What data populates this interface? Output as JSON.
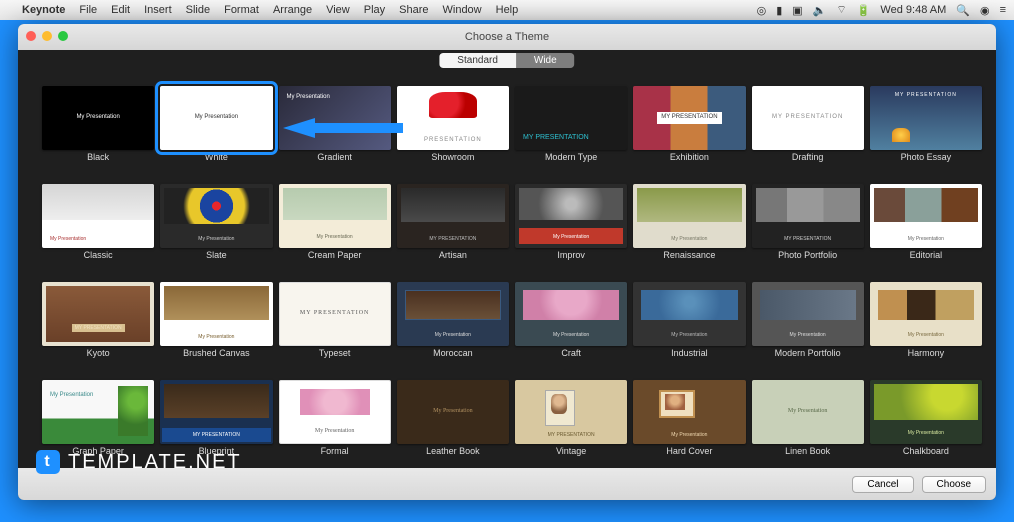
{
  "menubar": {
    "app_name": "Keynote",
    "items": [
      "File",
      "Edit",
      "Insert",
      "Slide",
      "Format",
      "Arrange",
      "View",
      "Play",
      "Share",
      "Window",
      "Help"
    ],
    "right_time": "Wed 9:48 AM"
  },
  "window": {
    "title": "Choose a Theme",
    "segmented": {
      "left": "Standard",
      "right": "Wide",
      "active_index": 0
    }
  },
  "themes": [
    {
      "name": "Black",
      "inner": "My Presentation"
    },
    {
      "name": "White",
      "inner": "My Presentation",
      "selected": true
    },
    {
      "name": "Gradient",
      "inner": "My Presentation"
    },
    {
      "name": "Showroom",
      "inner": "PRESENTATION"
    },
    {
      "name": "Modern Type",
      "inner": "MY PRESENTATION"
    },
    {
      "name": "Exhibition",
      "inner": "MY PRESENTATION"
    },
    {
      "name": "Drafting",
      "inner": "MY PRESENTATION"
    },
    {
      "name": "Photo Essay",
      "inner": "MY PRESENTATION"
    },
    {
      "name": "Classic",
      "inner": "My Presentation"
    },
    {
      "name": "Slate",
      "inner": "My Presentation"
    },
    {
      "name": "Cream Paper",
      "inner": "My Presentation"
    },
    {
      "name": "Artisan",
      "inner": "MY PRESENTATION"
    },
    {
      "name": "Improv",
      "inner": "My Presentation"
    },
    {
      "name": "Renaissance",
      "inner": "My Presentation"
    },
    {
      "name": "Photo Portfolio",
      "inner": "MY PRESENTATION"
    },
    {
      "name": "Editorial",
      "inner": "My Presentation"
    },
    {
      "name": "Kyoto",
      "inner": "MY PRESENTATION"
    },
    {
      "name": "Brushed Canvas",
      "inner": "My Presentation"
    },
    {
      "name": "Typeset",
      "inner": "MY PRESENTATION"
    },
    {
      "name": "Moroccan",
      "inner": "My Presentation"
    },
    {
      "name": "Craft",
      "inner": "My Presentation"
    },
    {
      "name": "Industrial",
      "inner": "My Presentation"
    },
    {
      "name": "Modern Portfolio",
      "inner": "My Presentation"
    },
    {
      "name": "Harmony",
      "inner": "My Presentation"
    },
    {
      "name": "Graph Paper",
      "inner": "My\nPresentation"
    },
    {
      "name": "Blueprint",
      "inner": "MY PRESENTATION"
    },
    {
      "name": "Formal",
      "inner": "My Presentation"
    },
    {
      "name": "Leather Book",
      "inner": "My Presentation"
    },
    {
      "name": "Vintage",
      "inner": "MY PRESENTATION"
    },
    {
      "name": "Hard Cover",
      "inner": "My Presentation"
    },
    {
      "name": "Linen Book",
      "inner": "My Presentation"
    },
    {
      "name": "Chalkboard",
      "inner": "My Presentation"
    }
  ],
  "footer": {
    "cancel": "Cancel",
    "choose": "Choose"
  },
  "watermark": "TEMPLATE.NET"
}
